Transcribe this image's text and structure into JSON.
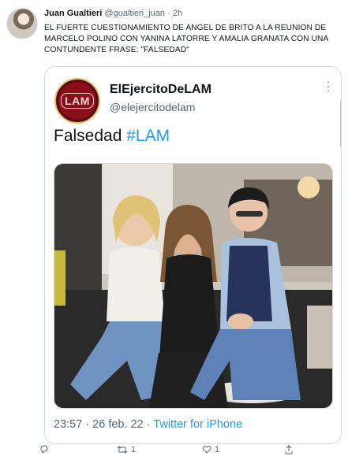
{
  "tweet": {
    "author_name": "Juan Gualtieri",
    "handle": "@gualtieri_juan",
    "separator": "·",
    "time": "2h",
    "text": "EL FUERTE CUESTIONAMIENTO DE ANGEL DE BRITO A LA REUNION DE MARCELO POLINO CON YANINA LATORRE Y AMALIA GRANATA CON UNA CONTUNDENTE FRASE: \"FALSEDAD\""
  },
  "quoted": {
    "logo_text": "LAM",
    "account_name": "ElEjercitoDeLAM",
    "account_handle": "@elejercitodelam",
    "more_glyph": "⋮",
    "body": "Falsedad",
    "hashtag": "#LAM",
    "timestamp": "23:57 · 26 feb. 22 · ",
    "source": "Twitter for iPhone"
  },
  "actions": {
    "reply_count": "",
    "retweet_count": "1",
    "like_count": "1",
    "share_count": ""
  }
}
